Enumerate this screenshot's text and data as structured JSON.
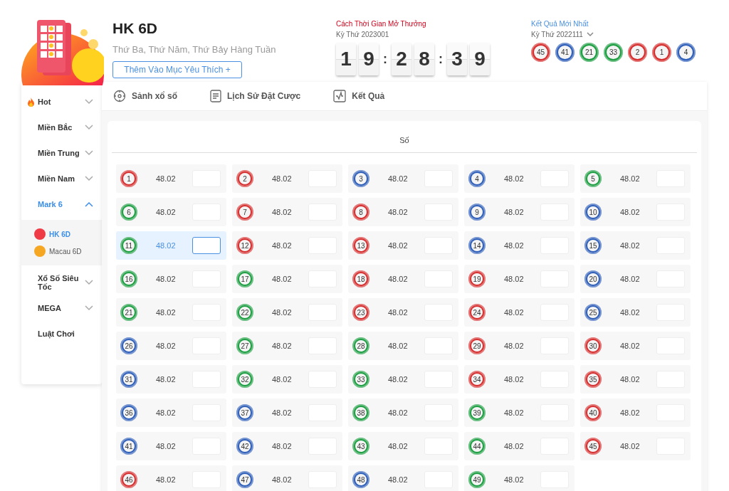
{
  "header": {
    "title": "HK 6D",
    "schedule": "Thứ Ba, Thứ Năm, Thứ Bảy Hàng Tuần",
    "favorite_button": "Thêm Vào Mục Yêu Thích +"
  },
  "countdown": {
    "label": "Cách Thời Gian Mở Thưởng",
    "draw": "Kỳ Thứ 2023001",
    "parts": [
      {
        "kind": "digit",
        "text": "1"
      },
      {
        "kind": "digit",
        "text": "9"
      },
      {
        "kind": "separator",
        "text": ":"
      },
      {
        "kind": "digit",
        "text": "2"
      },
      {
        "kind": "digit",
        "text": "8"
      },
      {
        "kind": "separator",
        "text": ":"
      },
      {
        "kind": "digit",
        "text": "3"
      },
      {
        "kind": "digit",
        "text": "9"
      }
    ]
  },
  "latest_result": {
    "label": "Kết Quả Mới Nhất",
    "draw": "Kỳ Thứ 2022111",
    "balls": [
      {
        "number": "45",
        "color": "#d62f2f"
      },
      {
        "number": "41",
        "color": "#2f5fb8"
      },
      {
        "number": "21",
        "color": "#1e9e43"
      },
      {
        "number": "33",
        "color": "#1e9e43"
      },
      {
        "number": "2",
        "color": "#d62f2f"
      },
      {
        "number": "1",
        "color": "#d62f2f"
      },
      {
        "number": "4",
        "color": "#2f5fb8"
      }
    ]
  },
  "sidebar": {
    "items": [
      {
        "label": "Hot",
        "kind": "hot",
        "expanded": false
      },
      {
        "label": "Miền Bắc",
        "kind": "plain",
        "expanded": false
      },
      {
        "label": "Miền Trung",
        "kind": "plain",
        "expanded": false
      },
      {
        "label": "Miền Nam",
        "kind": "plain",
        "expanded": false
      },
      {
        "label": "Mark 6",
        "kind": "plain",
        "expanded": true,
        "children": [
          {
            "label": "HK 6D",
            "selected": true
          },
          {
            "label": "Macau 6D",
            "selected": false
          }
        ]
      },
      {
        "label": "Xổ Số Siêu Tốc",
        "kind": "plain",
        "expanded": false
      },
      {
        "label": "MEGA",
        "kind": "plain",
        "expanded": false
      },
      {
        "label": "Luật Chơi",
        "kind": "link"
      }
    ]
  },
  "tabs": [
    {
      "label": "Sảnh xổ số",
      "kind": "target"
    },
    {
      "label": "Lịch Sử Đặt Cược",
      "kind": "document"
    },
    {
      "label": "Kết Quả",
      "kind": "chart"
    }
  ],
  "board": {
    "heading": "Số",
    "cells": [
      {
        "number": "1",
        "color": "#d62f2f",
        "odds": "48.02",
        "selected": false
      },
      {
        "number": "2",
        "color": "#d62f2f",
        "odds": "48.02",
        "selected": false
      },
      {
        "number": "3",
        "color": "#2f5fb8",
        "odds": "48.02",
        "selected": false
      },
      {
        "number": "4",
        "color": "#2f5fb8",
        "odds": "48.02",
        "selected": false
      },
      {
        "number": "5",
        "color": "#1e9e43",
        "odds": "48.02",
        "selected": false
      },
      {
        "number": "6",
        "color": "#1e9e43",
        "odds": "48.02",
        "selected": false
      },
      {
        "number": "7",
        "color": "#d62f2f",
        "odds": "48.02",
        "selected": false
      },
      {
        "number": "8",
        "color": "#d62f2f",
        "odds": "48.02",
        "selected": false
      },
      {
        "number": "9",
        "color": "#2f5fb8",
        "odds": "48.02",
        "selected": false
      },
      {
        "number": "10",
        "color": "#2f5fb8",
        "odds": "48.02",
        "selected": false
      },
      {
        "number": "11",
        "color": "#1e9e43",
        "odds": "48.02",
        "selected": true
      },
      {
        "number": "12",
        "color": "#d62f2f",
        "odds": "48.02",
        "selected": false
      },
      {
        "number": "13",
        "color": "#d62f2f",
        "odds": "48.02",
        "selected": false
      },
      {
        "number": "14",
        "color": "#2f5fb8",
        "odds": "48.02",
        "selected": false
      },
      {
        "number": "15",
        "color": "#2f5fb8",
        "odds": "48.02",
        "selected": false
      },
      {
        "number": "16",
        "color": "#1e9e43",
        "odds": "48.02",
        "selected": false
      },
      {
        "number": "17",
        "color": "#1e9e43",
        "odds": "48.02",
        "selected": false
      },
      {
        "number": "18",
        "color": "#d62f2f",
        "odds": "48.02",
        "selected": false
      },
      {
        "number": "19",
        "color": "#d62f2f",
        "odds": "48.02",
        "selected": false
      },
      {
        "number": "20",
        "color": "#2f5fb8",
        "odds": "48.02",
        "selected": false
      },
      {
        "number": "21",
        "color": "#1e9e43",
        "odds": "48.02",
        "selected": false
      },
      {
        "number": "22",
        "color": "#1e9e43",
        "odds": "48.02",
        "selected": false
      },
      {
        "number": "23",
        "color": "#d62f2f",
        "odds": "48.02",
        "selected": false
      },
      {
        "number": "24",
        "color": "#d62f2f",
        "odds": "48.02",
        "selected": false
      },
      {
        "number": "25",
        "color": "#2f5fb8",
        "odds": "48.02",
        "selected": false
      },
      {
        "number": "26",
        "color": "#2f5fb8",
        "odds": "48.02",
        "selected": false
      },
      {
        "number": "27",
        "color": "#1e9e43",
        "odds": "48.02",
        "selected": false
      },
      {
        "number": "28",
        "color": "#1e9e43",
        "odds": "48.02",
        "selected": false
      },
      {
        "number": "29",
        "color": "#d62f2f",
        "odds": "48.02",
        "selected": false
      },
      {
        "number": "30",
        "color": "#d62f2f",
        "odds": "48.02",
        "selected": false
      },
      {
        "number": "31",
        "color": "#2f5fb8",
        "odds": "48.02",
        "selected": false
      },
      {
        "number": "32",
        "color": "#1e9e43",
        "odds": "48.02",
        "selected": false
      },
      {
        "number": "33",
        "color": "#1e9e43",
        "odds": "48.02",
        "selected": false
      },
      {
        "number": "34",
        "color": "#d62f2f",
        "odds": "48.02",
        "selected": false
      },
      {
        "number": "35",
        "color": "#d62f2f",
        "odds": "48.02",
        "selected": false
      },
      {
        "number": "36",
        "color": "#2f5fb8",
        "odds": "48.02",
        "selected": false
      },
      {
        "number": "37",
        "color": "#2f5fb8",
        "odds": "48.02",
        "selected": false
      },
      {
        "number": "38",
        "color": "#1e9e43",
        "odds": "48.02",
        "selected": false
      },
      {
        "number": "39",
        "color": "#1e9e43",
        "odds": "48.02",
        "selected": false
      },
      {
        "number": "40",
        "color": "#d62f2f",
        "odds": "48.02",
        "selected": false
      },
      {
        "number": "41",
        "color": "#2f5fb8",
        "odds": "48.02",
        "selected": false
      },
      {
        "number": "42",
        "color": "#2f5fb8",
        "odds": "48.02",
        "selected": false
      },
      {
        "number": "43",
        "color": "#1e9e43",
        "odds": "48.02",
        "selected": false
      },
      {
        "number": "44",
        "color": "#1e9e43",
        "odds": "48.02",
        "selected": false
      },
      {
        "number": "45",
        "color": "#d62f2f",
        "odds": "48.02",
        "selected": false
      },
      {
        "number": "46",
        "color": "#d62f2f",
        "odds": "48.02",
        "selected": false
      },
      {
        "number": "47",
        "color": "#2f5fb8",
        "odds": "48.02",
        "selected": false
      },
      {
        "number": "48",
        "color": "#2f5fb8",
        "odds": "48.02",
        "selected": false
      },
      {
        "number": "49",
        "color": "#1e9e43",
        "odds": "48.02",
        "selected": false
      }
    ]
  }
}
